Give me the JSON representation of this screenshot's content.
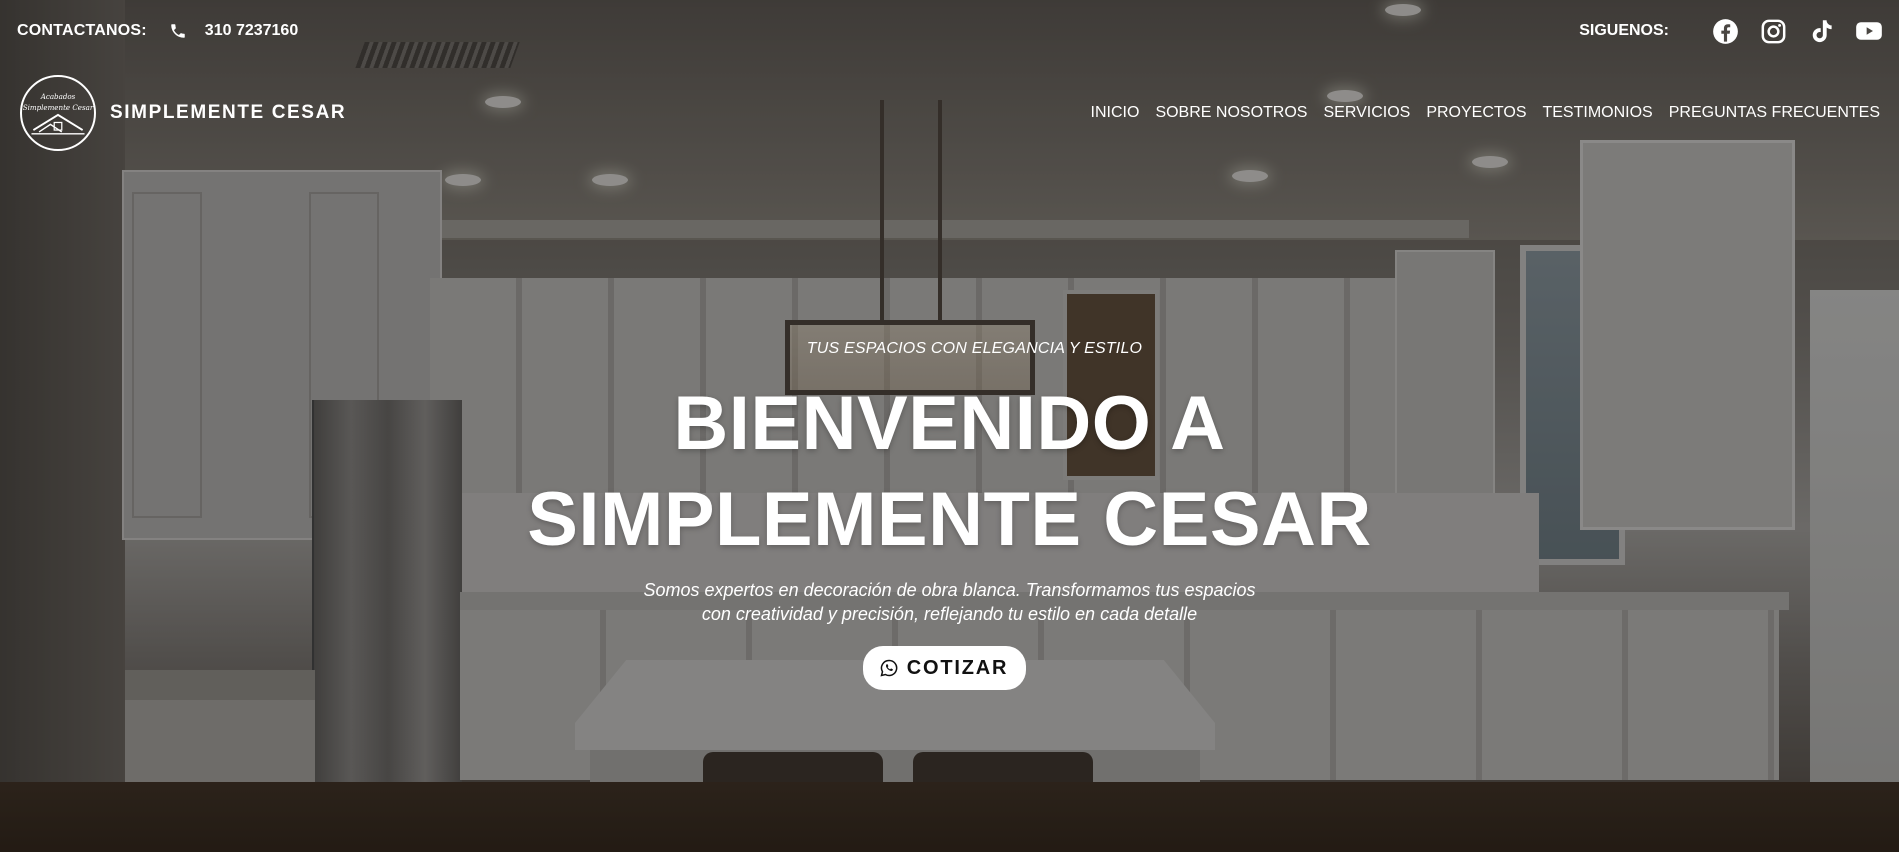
{
  "topbar": {
    "contact_label": "CONTACTANOS:",
    "phone_icon": "phone-icon",
    "phone": "310 7237160",
    "social_label": "SIGUENOS:",
    "social_icons": [
      "facebook-icon",
      "instagram-icon",
      "tiktok-icon",
      "youtube-icon"
    ]
  },
  "brand": {
    "name": "SIMPLEMENTE CESAR"
  },
  "nav": {
    "items": [
      {
        "label": "INICIO"
      },
      {
        "label": "SOBRE NOSOTROS"
      },
      {
        "label": "SERVICIOS"
      },
      {
        "label": "PROYECTOS"
      },
      {
        "label": "TESTIMONIOS"
      },
      {
        "label": "PREGUNTAS FRECUENTES"
      }
    ]
  },
  "hero": {
    "tagline": "TUS ESPACIOS CON ELEGANCIA Y ESTILO",
    "headline_line1": "BIENVENIDO A",
    "headline_line2": "SIMPLEMENTE CESAR",
    "subtitle_line1": "Somos expertos en decoración de obra blanca. Transformamos tus espacios",
    "subtitle_line2": "con creatividad y precisión, reflejando tu estilo en cada detalle",
    "cta_label": "COTIZAR",
    "cta_icon": "whatsapp-icon"
  },
  "colors": {
    "text": "#ffffff",
    "cta_bg": "#ffffff",
    "cta_text": "#111111",
    "overlay": "rgba(0,0,0,0.42)"
  }
}
